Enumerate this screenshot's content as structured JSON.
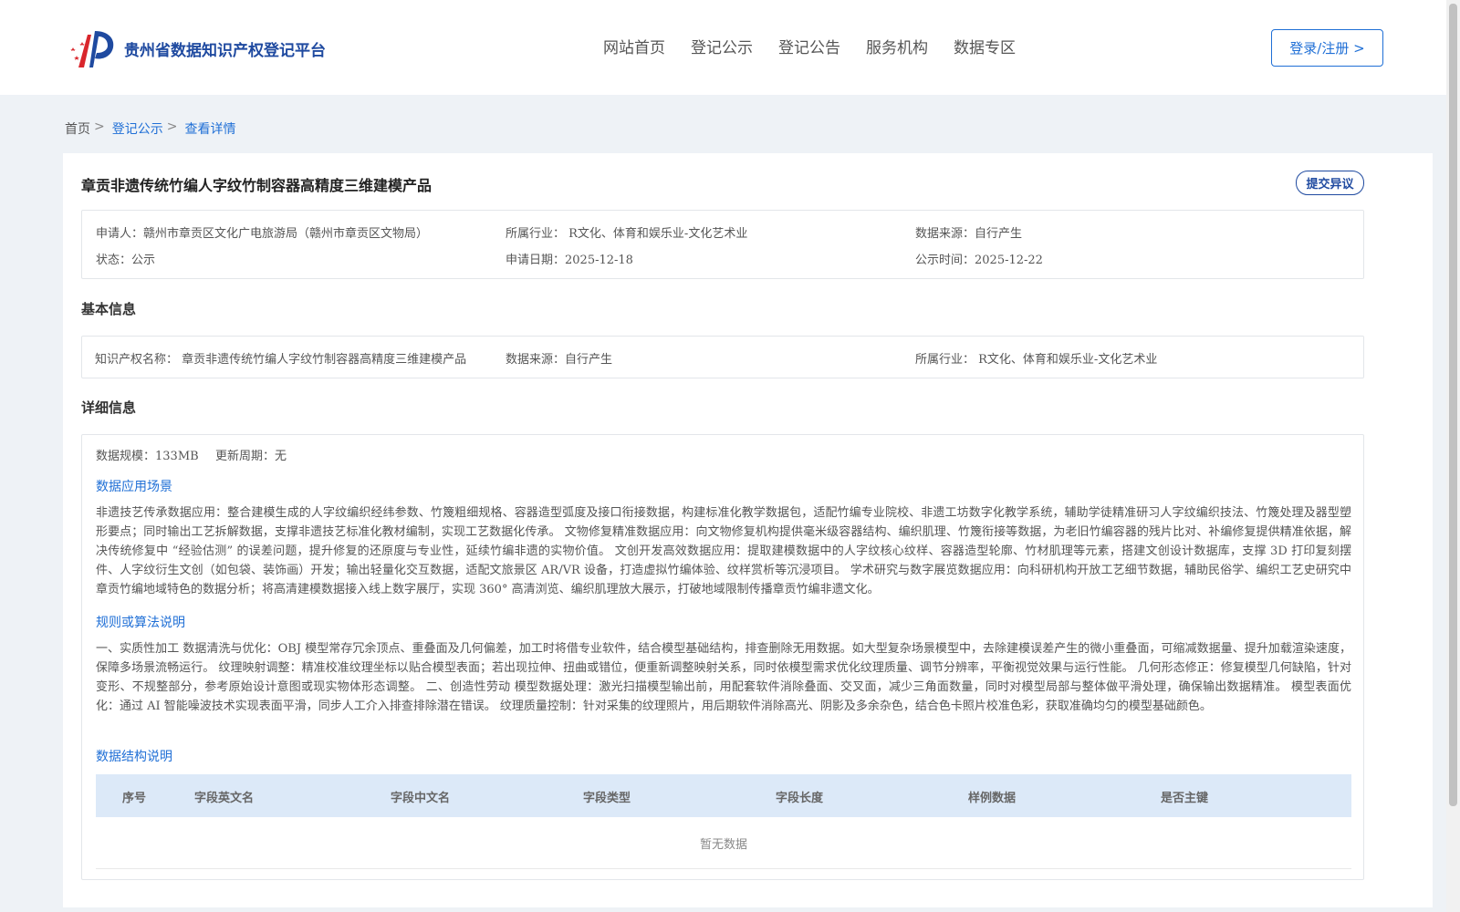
{
  "header": {
    "logo_text": "贵州省数据知识产权登记平台",
    "nav": [
      "网站首页",
      "登记公示",
      "登记公告",
      "服务机构",
      "数据专区"
    ],
    "login_label": "登录/注册 >"
  },
  "breadcrumb": {
    "home": "首页",
    "sep": ">",
    "level2": "登记公示",
    "current": "查看详情"
  },
  "detail": {
    "title": "章贡非遗传统竹编人字纹竹制容器高精度三维建模产品",
    "objection_label": "提交异议",
    "summary": {
      "applicant": "申请人：赣州市章贡区文化广电旅游局（赣州市章贡区文物局）",
      "industry": "所属行业： R文化、体育和娱乐业-文化艺术业",
      "source": "数据来源：自行产生",
      "status": "状态：公示",
      "apply_date": "申请日期：2025-12-18",
      "publish_date": "公示时间：2025-12-22"
    },
    "basic": {
      "section_title": "基本信息",
      "ip_name": "知识产权名称： 章贡非遗传统竹编人字纹竹制容器高精度三维建模产品",
      "source": "数据来源：自行产生",
      "industry": "所属行业： R文化、体育和娱乐业-文化艺术业"
    },
    "details": {
      "section_title": "详细信息",
      "scale": "数据规模：133MB",
      "cycle": "更新周期：无",
      "scene_title": "数据应用场景",
      "scene_text": "非遗技艺传承数据应用：整合建模生成的人字纹编织经纬参数、竹篾粗细规格、容器造型弧度及接口衔接数据，构建标准化教学数据包，适配竹编专业院校、非遗工坊数字化教学系统，辅助学徒精准研习人字纹编织技法、竹篾处理及器型塑形要点；同时输出工艺拆解数据，支撑非遗技艺标准化教材编制，实现工艺数据化传承。 文物修复精准数据应用：向文物修复机构提供毫米级容器结构、编织肌理、竹篾衔接等数据，为老旧竹编容器的残片比对、补编修复提供精准依据，解决传统修复中 “经验估测” 的误差问题，提升修复的还原度与专业性，延续竹编非遗的实物价值。 文创开发高效数据应用：提取建模数据中的人字纹核心纹样、容器造型轮廓、竹材肌理等元素，搭建文创设计数据库，支撑 3D 打印复刻摆件、人字纹衍生文创（如包袋、装饰画）开发；输出轻量化交互数据，适配文旅景区 AR/VR 设备，打造虚拟竹编体验、纹样赏析等沉浸项目。 学术研究与数字展览数据应用：向科研机构开放工艺细节数据，辅助民俗学、编织工艺史研究中章贡竹编地域特色的数据分析；将高清建模数据接入线上数字展厅，实现 360° 高清浏览、编织肌理放大展示，打破地域限制传播章贡竹编非遗文化。",
      "rule_title": "规则或算法说明",
      "rule_text": "一、实质性加工 数据清洗与优化：OBJ 模型常存冗余顶点、重叠面及几何偏差，加工时将借专业软件，结合模型基础结构，排查删除无用数据。如大型复杂场景模型中，去除建模误差产生的微小重叠面，可缩减数据量、提升加载渲染速度，保障多场景流畅运行。 纹理映射调整：精准校准纹理坐标以贴合模型表面；若出现拉伸、扭曲或错位，便重新调整映射关系，同时依模型需求优化纹理质量、调节分辨率，平衡视觉效果与运行性能。 几何形态修正：修复模型几何缺陷，针对变形、不规整部分，参考原始设计意图或现实物体形态调整。 二、创造性劳动 模型数据处理：激光扫描模型输出前，用配套软件消除叠面、交叉面，减少三角面数量，同时对模型局部与整体做平滑处理，确保输出数据精准。 模型表面优化：通过 AI 智能噪波技术实现表面平滑，同步人工介入排查排除潜在错误。 纹理质量控制：针对采集的纹理照片，用后期软件消除高光、阴影及多余杂色，结合色卡照片校准色彩，获取准确均匀的模型基础颜色。",
      "struct_title": "数据结构说明",
      "table_headers": [
        "序号",
        "字段英文名",
        "字段中文名",
        "字段类型",
        "字段长度",
        "样例数据",
        "是否主键"
      ],
      "empty_text": "暂无数据"
    }
  },
  "colors": {
    "accent": "#1f6fd6",
    "brand": "#1f4aa0",
    "table_header_bg": "#dce9f8",
    "page_bg": "#eef2f6"
  }
}
